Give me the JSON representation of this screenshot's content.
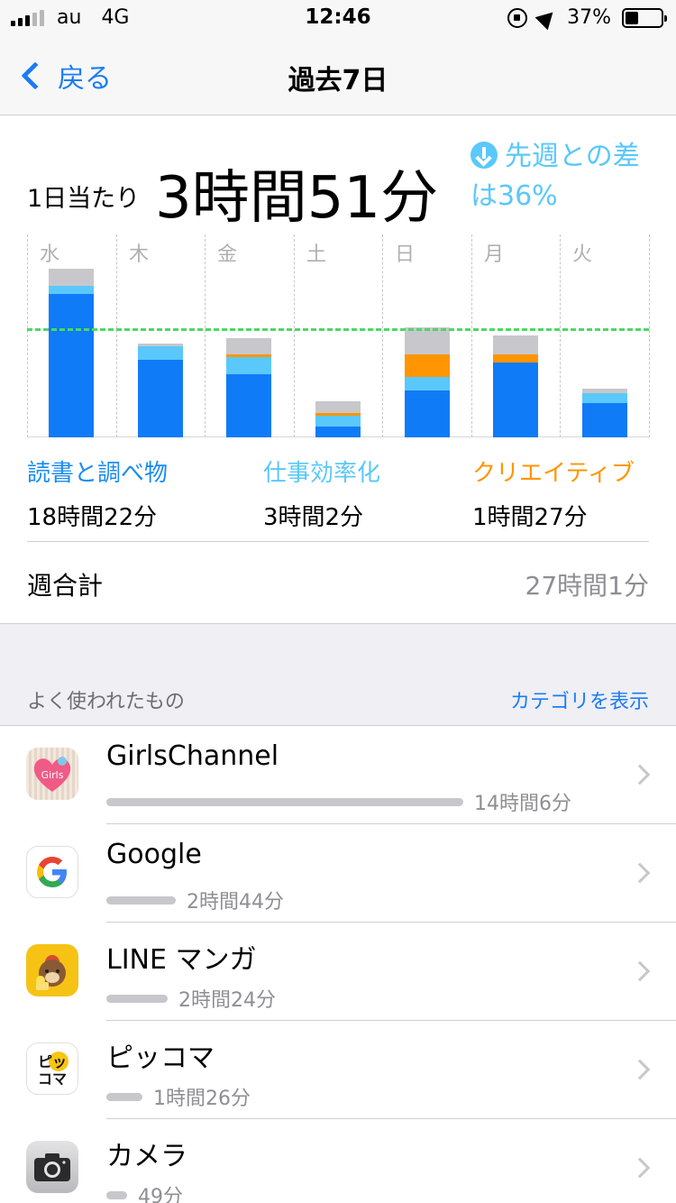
{
  "status_bar": {
    "carrier": "au",
    "network": "4G",
    "time": "12:46",
    "battery": "37%"
  },
  "nav": {
    "back_label": "戻る",
    "title": "過去7日"
  },
  "summary": {
    "avg_label": "1日当たり",
    "avg_value": "3時間51分",
    "diff_text": "先週との差は36%"
  },
  "chart_data": {
    "type": "bar",
    "stacked": true,
    "categories": [
      "水",
      "木",
      "金",
      "土",
      "日",
      "月",
      "火"
    ],
    "series": [
      {
        "name": "読書と調べ物",
        "color": "#0f7bf7",
        "values": [
          5.2,
          2.8,
          2.3,
          0.4,
          1.7,
          2.7,
          1.25
        ]
      },
      {
        "name": "仕事効率化",
        "color": "#5ac8fa",
        "values": [
          0.3,
          0.5,
          0.6,
          0.4,
          0.5,
          0.0,
          0.35
        ]
      },
      {
        "name": "クリエイティブ",
        "color": "#ff9500",
        "values": [
          0.0,
          0.0,
          0.1,
          0.1,
          0.8,
          0.3,
          0.0
        ]
      },
      {
        "name": "other",
        "color": "#c7c7cc",
        "values": [
          0.6,
          0.1,
          0.6,
          0.4,
          1.0,
          0.7,
          0.15
        ]
      }
    ],
    "average_line": 3.85,
    "ylim": [
      0,
      7.35
    ],
    "gridlines": "vertical-dashed",
    "average_line_color": "#4cd964"
  },
  "categories": [
    {
      "name": "読書と調べ物",
      "time": "18時間22分",
      "color": "#1a8cf0"
    },
    {
      "name": "仕事効率化",
      "time": "3時間2分",
      "color": "#5ac8fa"
    },
    {
      "name": "クリエイティブ",
      "time": "1時間27分",
      "color": "#ff9500"
    }
  ],
  "weekly": {
    "label": "週合計",
    "value": "27時間1分"
  },
  "section": {
    "title": "よく使われたもの",
    "link": "カテゴリを表示"
  },
  "apps": [
    {
      "name": "GirlsChannel",
      "time": "14時間6分",
      "usage": 1.0,
      "icon": "girlschannel-icon"
    },
    {
      "name": "Google",
      "time": "2時間44分",
      "usage": 0.194,
      "icon": "google-icon"
    },
    {
      "name": "LINE マンガ",
      "time": "2時間24分",
      "usage": 0.172,
      "icon": "line-manga-icon"
    },
    {
      "name": "ピッコマ",
      "time": "1時間26分",
      "usage": 0.102,
      "icon": "piccoma-icon"
    },
    {
      "name": "カメラ",
      "time": "49分",
      "usage": 0.058,
      "icon": "camera-icon"
    }
  ],
  "icon_texts": {
    "girls": "Girls",
    "piccoma_top": "ピッ",
    "piccoma_bottom": "コマ"
  }
}
